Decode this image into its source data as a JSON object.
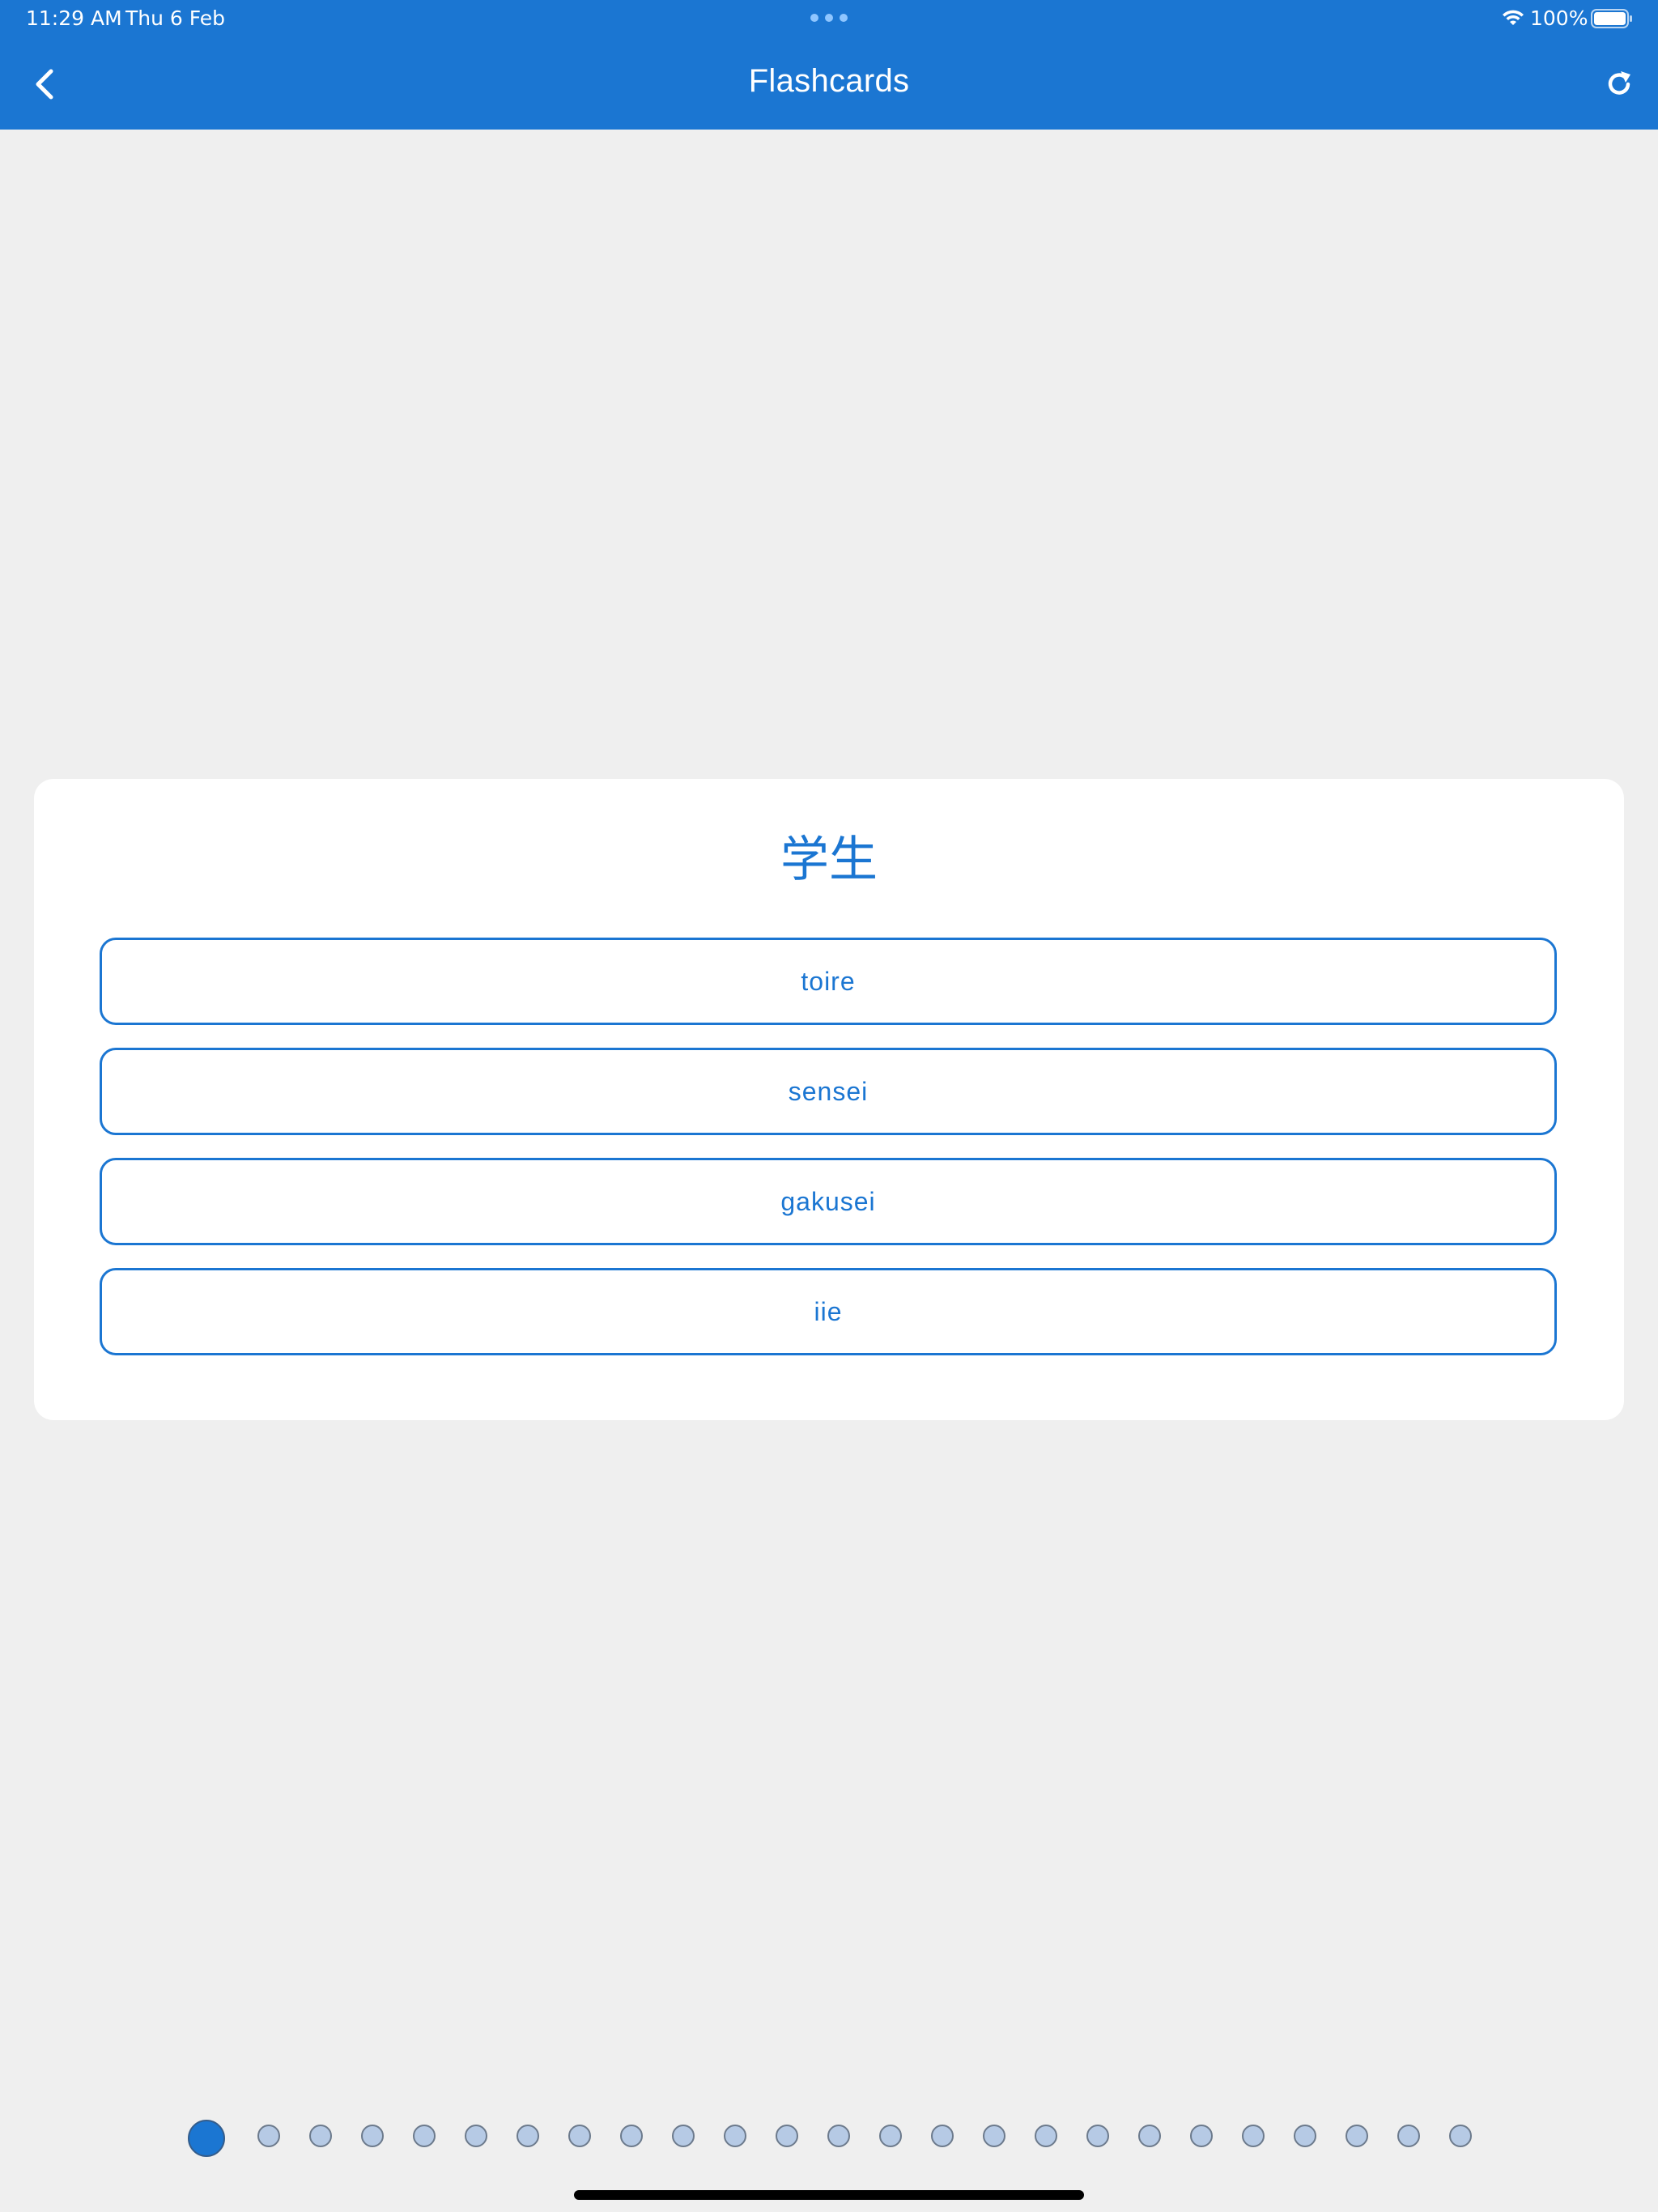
{
  "status_bar": {
    "time": "11:29 AM",
    "date": "Thu 6 Feb",
    "battery": "100%"
  },
  "nav": {
    "title": "Flashcards",
    "back_icon": "chevron-left-icon",
    "refresh_icon": "refresh-icon"
  },
  "card": {
    "prompt": "学生",
    "options": [
      "toire",
      "sensei",
      "gakusei",
      "iie"
    ]
  },
  "pager": {
    "total": 25,
    "current": 1
  },
  "colors": {
    "accent": "#1b76d2",
    "background": "#efefef",
    "card": "#ffffff",
    "dot_inactive": "#b6cae5"
  }
}
